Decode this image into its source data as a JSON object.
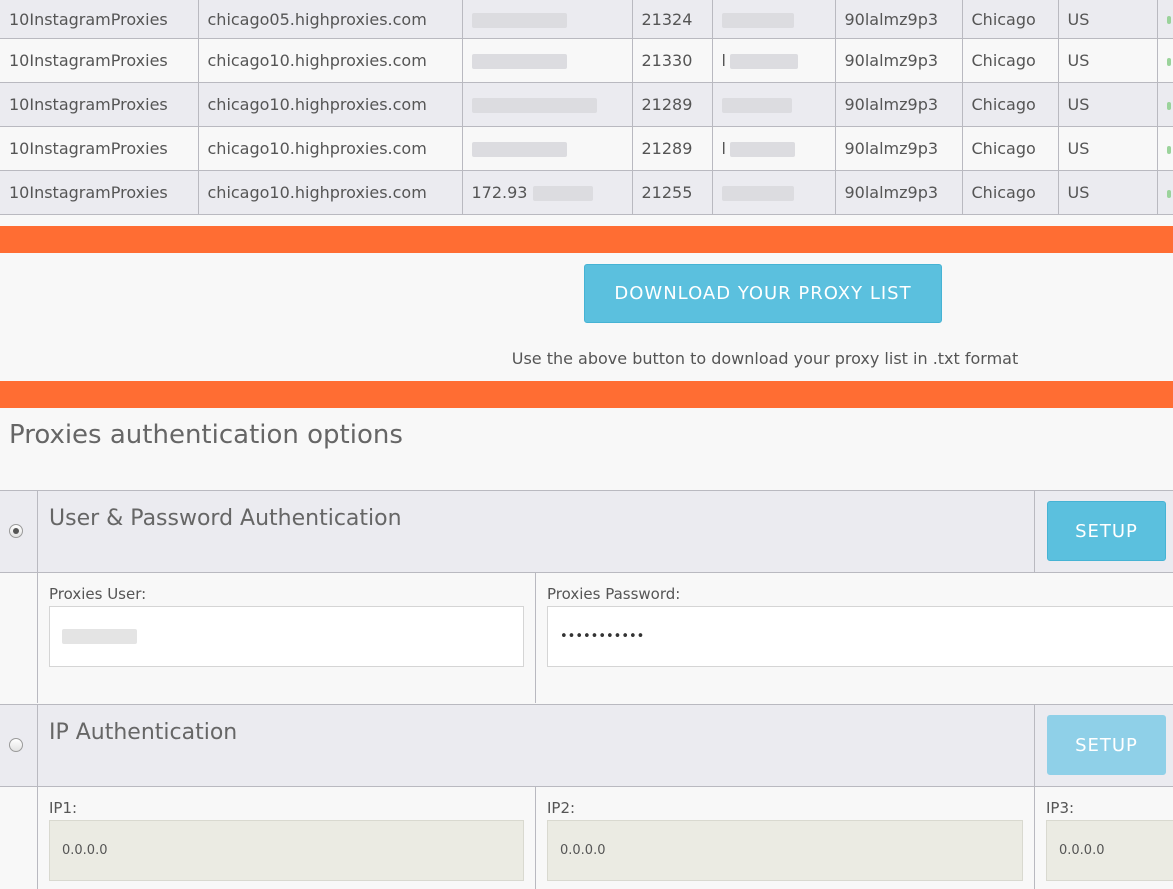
{
  "proxy_table": {
    "rows": [
      {
        "package": "10InstagramProxies",
        "host": "chicago05.highproxies.com",
        "ip": "",
        "port": "21324",
        "user": "",
        "password": "90lalmz9p3",
        "city": "Chicago",
        "country": "US"
      },
      {
        "package": "10InstagramProxies",
        "host": "chicago10.highproxies.com",
        "ip": "",
        "port": "21330",
        "user": "l",
        "password": "90lalmz9p3",
        "city": "Chicago",
        "country": "US"
      },
      {
        "package": "10InstagramProxies",
        "host": "chicago10.highproxies.com",
        "ip": "",
        "port": "21289",
        "user": "",
        "password": "90lalmz9p3",
        "city": "Chicago",
        "country": "US"
      },
      {
        "package": "10InstagramProxies",
        "host": "chicago10.highproxies.com",
        "ip": "",
        "port": "21289",
        "user": "l",
        "password": "90lalmz9p3",
        "city": "Chicago",
        "country": "US"
      },
      {
        "package": "10InstagramProxies",
        "host": "chicago10.highproxies.com",
        "ip": "172.93",
        "port": "21255",
        "user": "",
        "password": "90lalmz9p3",
        "city": "Chicago",
        "country": "US"
      }
    ]
  },
  "download": {
    "button_label": "DOWNLOAD YOUR PROXY LIST",
    "help_text": "Use the above button to download your proxy list in .txt format"
  },
  "auth": {
    "title": "Proxies authentication options",
    "user_pass": {
      "label": "User & Password Authentication",
      "setup_label": "SETUP",
      "user_label": "Proxies User:",
      "password_label": "Proxies Password:",
      "password_value": "•••••••••••"
    },
    "ip": {
      "label": "IP Authentication",
      "setup_label": "SETUP",
      "ip1_label": "IP1:",
      "ip2_label": "IP2:",
      "ip3_label": "IP3:",
      "ip1_placeholder": "0.0.0.0",
      "ip2_placeholder": "0.0.0.0",
      "ip3_placeholder": "0.0.0.0"
    }
  },
  "colors": {
    "accent_orange": "#ff6d33",
    "button_blue": "#5bc0de",
    "row_gray": "#ebebf0"
  }
}
